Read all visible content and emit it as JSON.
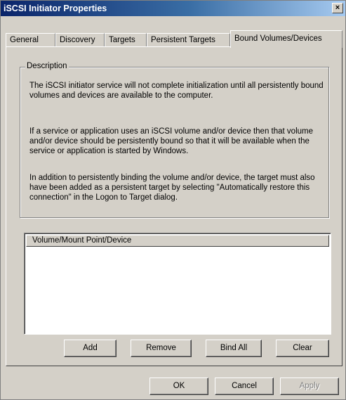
{
  "window": {
    "title": "iSCSI Initiator Properties",
    "close_glyph": "×"
  },
  "tabs": [
    {
      "label": "General"
    },
    {
      "label": "Discovery"
    },
    {
      "label": "Targets"
    },
    {
      "label": "Persistent Targets"
    },
    {
      "label": "Bound Volumes/Devices",
      "active": true
    }
  ],
  "description": {
    "legend": "Description",
    "paragraphs": [
      "The iSCSI initiator service will not complete initialization until all persistently bound volumes and devices are available to the computer.",
      "If a service or application uses an iSCSI volume and/or device then that volume and/or device should be persistently bound so that it will be available when the service or application is started by Windows.",
      "In addition to persistently binding the volume and/or device, the target must also have been added as a persistent target by selecting \"Automatically restore this connection\" in the Logon to Target dialog."
    ]
  },
  "volume_list": {
    "column_header": "Volume/Mount Point/Device",
    "rows": []
  },
  "action_buttons": {
    "add": "Add",
    "remove": "Remove",
    "bind_all": "Bind All",
    "clear": "Clear"
  },
  "dialog_buttons": {
    "ok": "OK",
    "cancel": "Cancel",
    "apply": "Apply",
    "apply_enabled": false
  }
}
